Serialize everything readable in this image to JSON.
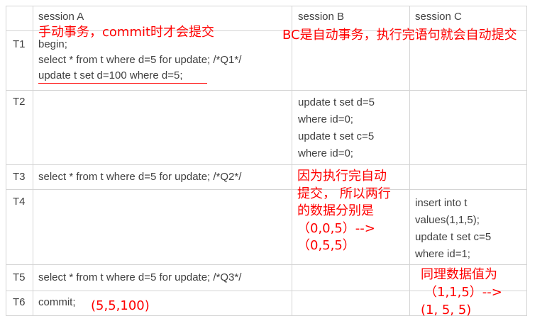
{
  "headers": {
    "sessionA": "session A",
    "sessionB": "session B",
    "sessionC": "session C"
  },
  "rows": {
    "T1": {
      "label": "T1",
      "a": [
        "begin;",
        "select * from t where d=5 for update; /*Q1*/",
        "update t set d=100 where d=5;"
      ]
    },
    "T2": {
      "label": "T2",
      "b": [
        "update t set d=5",
        "where id=0;",
        "update t set c=5",
        "where id=0;"
      ]
    },
    "T3": {
      "label": "T3",
      "a": [
        "select * from t where d=5 for update; /*Q2*/"
      ]
    },
    "T4": {
      "label": "T4",
      "c": [
        "insert into t",
        "values(1,1,5);",
        "update t set c=5",
        "where id=1;"
      ]
    },
    "T5": {
      "label": "T5",
      "a": [
        "select * from t where d=5 for update; /*Q3*/"
      ]
    },
    "T6": {
      "label": "T6",
      "a": [
        "commit;"
      ]
    }
  },
  "annotations": {
    "sessionA_note": "手动事务，commit时才会提交",
    "bc_note": "BC是自动事务，执行完语句就会自动提交",
    "b_note": [
      "因为执行完自动",
      "提交，  所以两行",
      "的数据分别是",
      "（0,0,5）-->",
      "（0,5,5）"
    ],
    "c_note": [
      "同理数据值为",
      "（1,1,5）-->",
      "(1, 5, 5)"
    ],
    "commit_note": "(5,5,100)",
    "color": "#ff0000"
  }
}
